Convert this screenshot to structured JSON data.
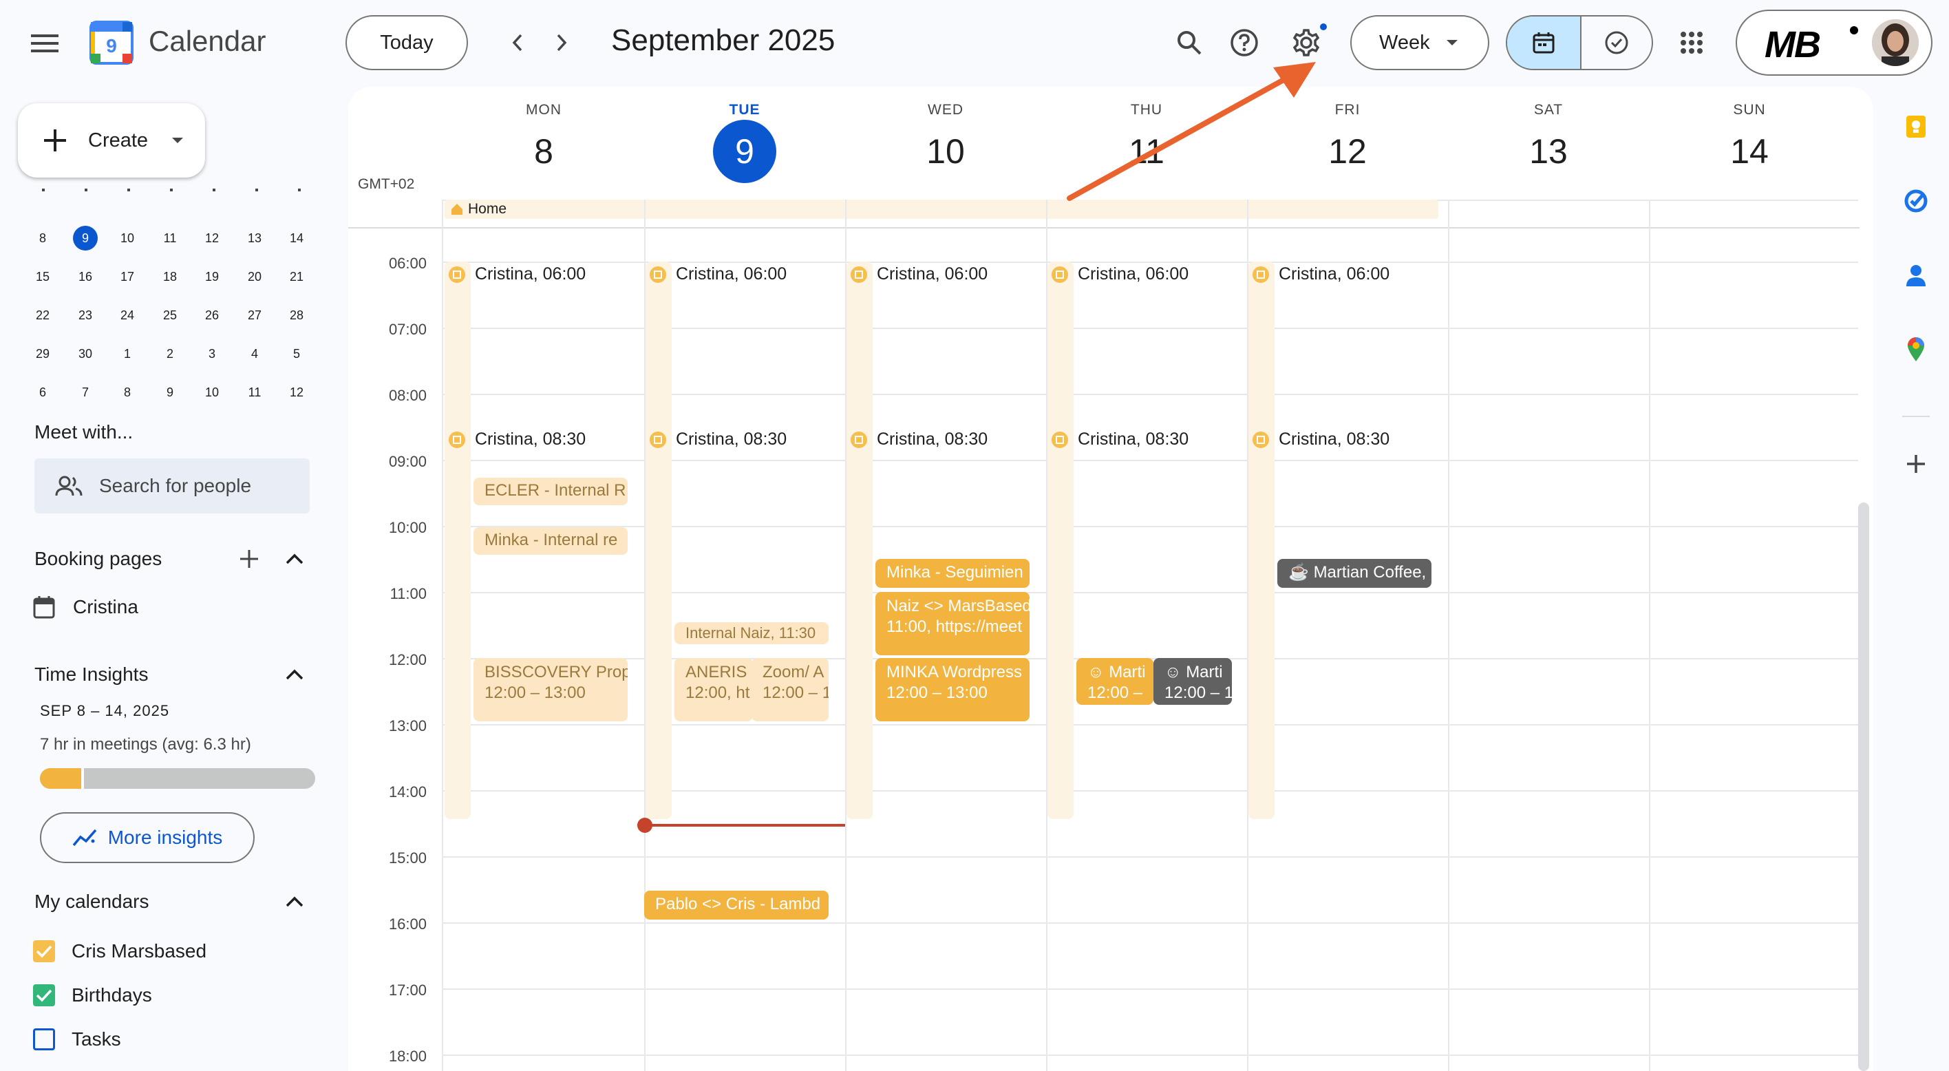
{
  "app": {
    "name": "Calendar",
    "logo_number": "9",
    "today_label": "Today",
    "date_range": "September 2025",
    "view_label": "Week",
    "account_logo_text": "MB"
  },
  "colors": {
    "accent": "#0b57d0",
    "selected_view": "#c2e7ff",
    "event_gold": "#f2b43f",
    "event_pale": "#fce6c3",
    "event_dark": "#616161",
    "current_time": "#c5432b",
    "annotation_arrow": "#e8632e",
    "insight_bar": "#f2b43f"
  },
  "sidebar": {
    "create_label": "Create",
    "mini_calendar": {
      "rows": [
        [
          "8",
          "9",
          "10",
          "11",
          "12",
          "13",
          "14"
        ],
        [
          "15",
          "16",
          "17",
          "18",
          "19",
          "20",
          "21"
        ],
        [
          "22",
          "23",
          "24",
          "25",
          "26",
          "27",
          "28"
        ],
        [
          "29",
          "30",
          "1",
          "2",
          "3",
          "4",
          "5"
        ],
        [
          "6",
          "7",
          "8",
          "9",
          "10",
          "11",
          "12"
        ]
      ],
      "selected": "9"
    },
    "meet_title": "Meet with...",
    "search_people_placeholder": "Search for people",
    "booking_title": "Booking pages",
    "booking_item": "Cristina",
    "insights_title": "Time Insights",
    "insights_range": "SEP 8 – 14, 2025",
    "insights_summary": "7 hr in meetings (avg: 6.3 hr)",
    "insights_fraction": 0.16,
    "more_insights": "More insights",
    "my_calendars_title": "My calendars",
    "calendars": [
      {
        "label": "Cris Marsbased",
        "color": "#f6bf4d",
        "checked": true
      },
      {
        "label": "Birthdays",
        "color": "#33b679",
        "checked": true
      },
      {
        "label": "Tasks",
        "color": "#0b57d0",
        "checked": false
      }
    ]
  },
  "week": {
    "timezone": "GMT+02",
    "days": [
      {
        "name": "MON",
        "num": "8"
      },
      {
        "name": "TUE",
        "num": "9",
        "today": true
      },
      {
        "name": "WED",
        "num": "10"
      },
      {
        "name": "THU",
        "num": "11"
      },
      {
        "name": "FRI",
        "num": "12"
      },
      {
        "name": "SAT",
        "num": "13"
      },
      {
        "name": "SUN",
        "num": "14"
      }
    ],
    "allday_event": "Home",
    "hours": [
      "06:00",
      "07:00",
      "08:00",
      "09:00",
      "10:00",
      "11:00",
      "12:00",
      "13:00",
      "14:00",
      "15:00",
      "16:00",
      "17:00",
      "18:00"
    ],
    "ooo_blocks": {
      "morning": "Cristina, 06:00",
      "work": "Cristina, 08:30"
    },
    "events": {
      "ecler": "ECLER - Internal R",
      "minka_internal": "Minka - Internal re",
      "bisscovery_title": "BISSCOVERY Prop",
      "bisscovery_time": "12:00 – 13:00",
      "internal_naiz": "Internal Naiz, 11:30",
      "aneris_title": "ANERIS",
      "aneris_time": "12:00, ht",
      "zoom_title": "Zoom/ A",
      "zoom_time": "12:00 – 1",
      "pablo": "Pablo <> Cris - Lambd",
      "minka_seg": "Minka - Seguimien",
      "naiz_title": "Naiz <> MarsBased",
      "naiz_time": "11:00, https://meet",
      "minka_wp_title": "MINKA Wordpress",
      "minka_wp_time": "12:00 – 13:00",
      "thu_a_title": "Marti",
      "thu_a_time": "12:00 –",
      "thu_b_title": "Marti",
      "thu_b_time": "12:00 – 1",
      "martian_coffee": "Martian Coffee,"
    }
  }
}
